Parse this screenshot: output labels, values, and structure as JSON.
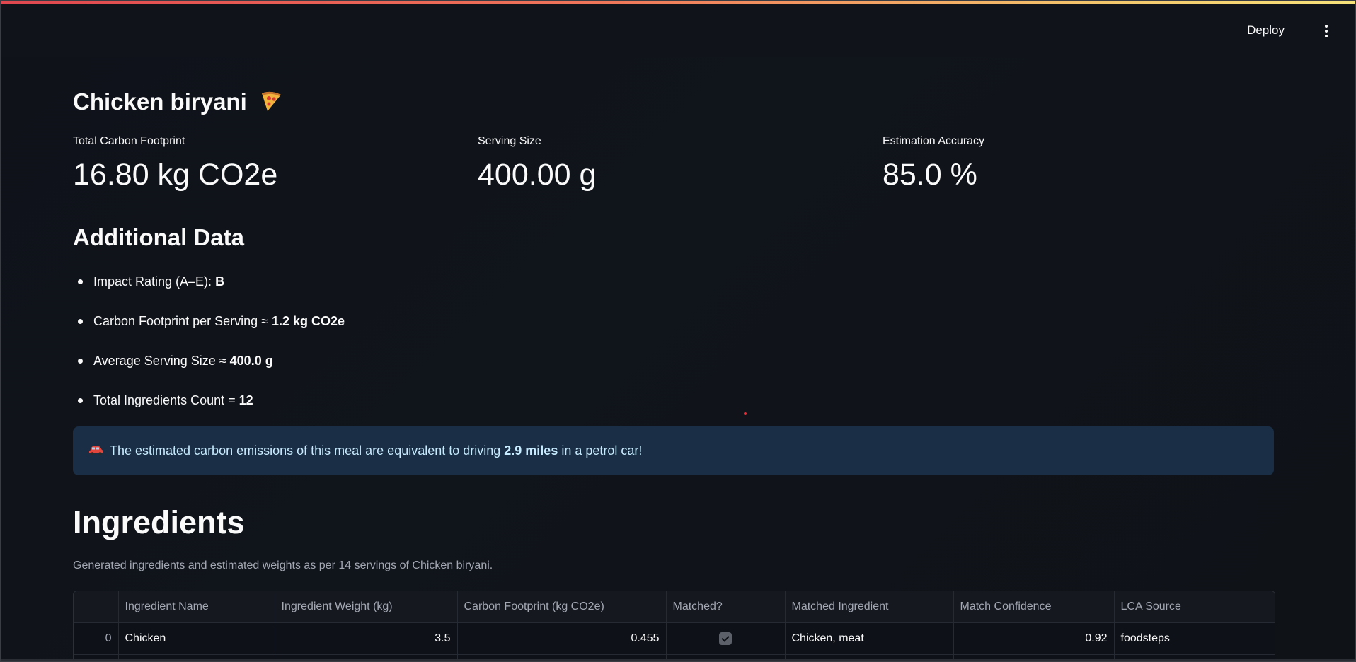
{
  "header": {
    "deploy_label": "Deploy",
    "menu_icon": "kebab-menu-icon"
  },
  "page": {
    "title": "Chicken biryani",
    "title_emoji": "pizza-icon"
  },
  "metrics": [
    {
      "label": "Total Carbon Footprint",
      "value": "16.80 kg CO2e"
    },
    {
      "label": "Serving Size",
      "value": "400.00 g"
    },
    {
      "label": "Estimation Accuracy",
      "value": "85.0 %"
    }
  ],
  "additional": {
    "heading": "Additional Data",
    "items": [
      {
        "label": "Impact Rating (A–E): ",
        "value": "B"
      },
      {
        "label": "Carbon Footprint per Serving ≈ ",
        "value": "1.2 kg CO2e"
      },
      {
        "label": "Average Serving Size ≈ ",
        "value": "400.0 g"
      },
      {
        "label": "Total Ingredients Count = ",
        "value": "12"
      }
    ]
  },
  "info": {
    "icon": "car-icon",
    "prefix": "The estimated carbon emissions of this meal are equivalent to driving ",
    "highlight": "2.9 miles",
    "suffix": " in a petrol car!"
  },
  "ingredients": {
    "heading": "Ingredients",
    "caption": "Generated ingredients and estimated weights as per 14 servings of Chicken biryani.",
    "columns": [
      "",
      "Ingredient Name",
      "Ingredient Weight (kg)",
      "Carbon Footprint (kg CO2e)",
      "Matched?",
      "Matched Ingredient",
      "Match Confidence",
      "LCA Source"
    ],
    "rows": [
      {
        "index": "0",
        "name": "Chicken",
        "weight": "3.5",
        "footprint": "0.455",
        "matched": true,
        "matched_ingredient": "Chicken, meat",
        "confidence": "0.92",
        "source": "foodsteps"
      }
    ]
  },
  "colors": {
    "background": "#0e1117",
    "info_bg": "#1a2e45",
    "info_text": "#c7ebff",
    "accent_stripe_start": "#e0474f",
    "accent_stripe_end": "#f7e27a"
  }
}
